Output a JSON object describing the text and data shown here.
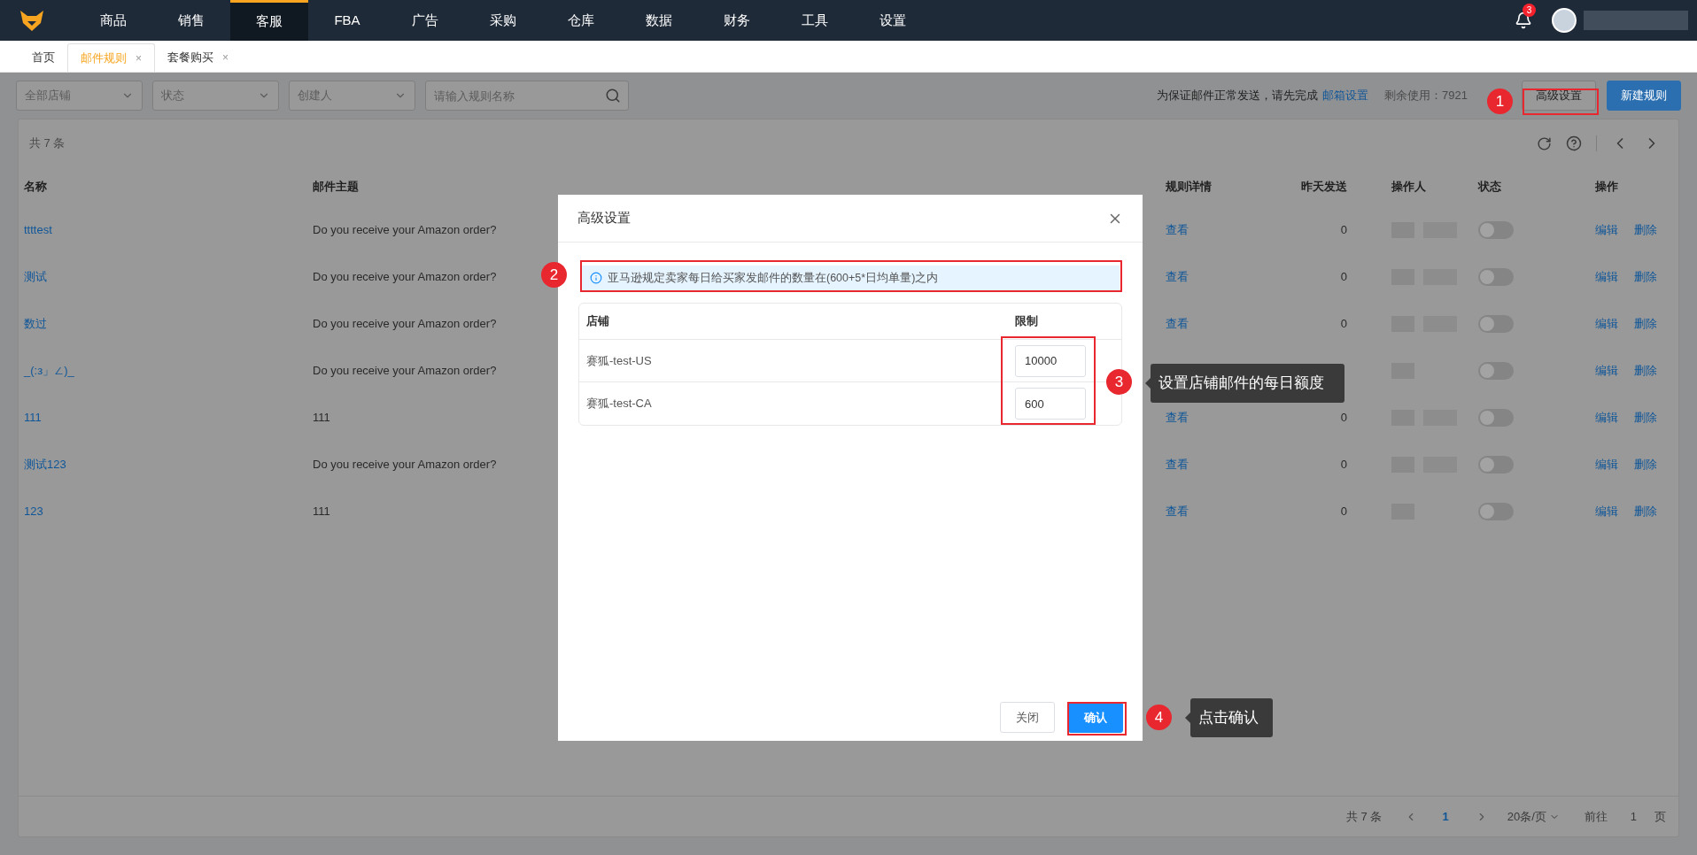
{
  "nav": {
    "items": [
      {
        "label": "商品",
        "selected": false
      },
      {
        "label": "销售",
        "selected": false
      },
      {
        "label": "客服",
        "selected": true
      },
      {
        "label": "FBA",
        "selected": false
      },
      {
        "label": "广告",
        "selected": false
      },
      {
        "label": "采购",
        "selected": false
      },
      {
        "label": "仓库",
        "selected": false
      },
      {
        "label": "数据",
        "selected": false
      },
      {
        "label": "财务",
        "selected": false
      },
      {
        "label": "工具",
        "selected": false
      },
      {
        "label": "设置",
        "selected": false
      }
    ],
    "notification_count": "3"
  },
  "tabs": [
    {
      "label": "首页",
      "selected": false
    },
    {
      "label": "邮件规则",
      "selected": true,
      "close": "×"
    },
    {
      "label": "套餐购买",
      "selected": false,
      "close": "×"
    }
  ],
  "filters": {
    "selects": [
      {
        "placeholder": "全部店铺"
      },
      {
        "placeholder": "状态"
      },
      {
        "placeholder": "创建人"
      }
    ],
    "search": {
      "placeholder": "请输入规则名称"
    }
  },
  "notice": {
    "text": "为保证邮件正常发送，请先完成",
    "link": "邮箱设置",
    "remaining": "剩余使用：7921"
  },
  "buttons": [
    {
      "label": "高级设置",
      "kind": "default"
    },
    {
      "label": "新建规则",
      "kind": "primary"
    }
  ],
  "table": {
    "total": "共 7 条",
    "columns": [
      "名称",
      "邮件主题",
      "规则详情",
      "昨天发送",
      "操作人",
      "状态",
      "操作"
    ],
    "rows": [
      {
        "name": "ttttest",
        "subject": "Do you receive your Amazon order?",
        "detail": "查看",
        "sent": "0",
        "on": false,
        "actions": [
          "编辑",
          "删除"
        ]
      },
      {
        "name": "测试",
        "subject": "Do you receive your Amazon order?",
        "detail": "查看",
        "sent": "0",
        "on": false,
        "actions": [
          "编辑",
          "删除"
        ]
      },
      {
        "name": "数过",
        "subject": "Do you receive your Amazon order?",
        "detail": "查看",
        "sent": "0",
        "on": false,
        "actions": [
          "编辑",
          "删除"
        ]
      },
      {
        "name": "_(:з」∠)_",
        "subject": "Do you receive your Amazon order?",
        "on": false,
        "actions": [
          "编辑",
          "删除"
        ]
      },
      {
        "name": "111",
        "subject": "111",
        "detail": "查看",
        "sent": "0",
        "on": false,
        "actions": [
          "编辑",
          "删除"
        ]
      },
      {
        "name": "测试123",
        "subject": "Do you receive your Amazon order?",
        "detail": "查看",
        "sent": "0",
        "on": false,
        "actions": [
          "编辑",
          "删除"
        ]
      },
      {
        "name": "123",
        "subject": "111",
        "detail": "查看",
        "sent": "0",
        "on": false,
        "actions": [
          "编辑",
          "删除"
        ]
      }
    ]
  },
  "pagination": {
    "total": "共 7 条",
    "page": "1",
    "page_size": "20条/页",
    "goto": "前往",
    "goto_value": "1",
    "unit": "页"
  },
  "modal": {
    "title": "高级设置",
    "alert": "亚马逊规定卖家每日给买家发邮件的数量在(600+5*日均单量)之内",
    "columns": [
      "店铺",
      "限制"
    ],
    "rows": [
      {
        "shop": "赛狐-test-US",
        "limit": "10000"
      },
      {
        "shop": "赛狐-test-CA",
        "limit": "600"
      }
    ],
    "buttons": [
      {
        "label": "关闭",
        "kind": "default"
      },
      {
        "label": "确认",
        "kind": "primary"
      }
    ]
  },
  "annotations": [
    {
      "number": "1"
    },
    {
      "number": "2"
    },
    {
      "number": "3",
      "tip": "设置店铺邮件的每日额度"
    },
    {
      "number": "4",
      "tip": "点击确认"
    }
  ]
}
